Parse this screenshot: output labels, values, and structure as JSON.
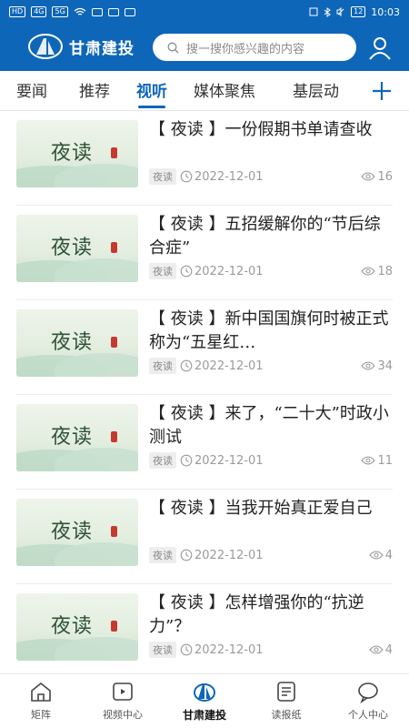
{
  "status_bar": {
    "left_indicators": [
      "HD",
      "4G",
      "5G"
    ],
    "time": "10:03",
    "battery": "12"
  },
  "header": {
    "app_title": "甘肃建投",
    "search_placeholder": "搜一搜你感兴趣的内容",
    "brand_color": "#0e66b8"
  },
  "tabs": [
    {
      "label": "要闻",
      "active": false
    },
    {
      "label": "推荐",
      "active": false
    },
    {
      "label": "视听",
      "active": true
    },
    {
      "label": "媒体聚焦",
      "active": false
    },
    {
      "label": "基层动",
      "active": false
    }
  ],
  "thumb_text": "夜读",
  "articles": [
    {
      "title": "【 夜读 】一份假期书单请查收",
      "tag": "夜读",
      "date": "2022-12-01",
      "views": "16"
    },
    {
      "title": "【 夜读 】五招缓解你的“节后综合症”",
      "tag": "夜读",
      "date": "2022-12-01",
      "views": "18"
    },
    {
      "title": "【 夜读 】新中国国旗何时被正式称为“五星红…",
      "tag": "夜读",
      "date": "2022-12-01",
      "views": "34"
    },
    {
      "title": "【 夜读 】来了，“二十大”时政小测试",
      "tag": "夜读",
      "date": "2022-12-01",
      "views": "11"
    },
    {
      "title": "【 夜读 】当我开始真正爱自己",
      "tag": "夜读",
      "date": "2022-12-01",
      "views": "4"
    },
    {
      "title": "【 夜读 】怎样增强你的“抗逆力”？",
      "tag": "夜读",
      "date": "2022-12-01",
      "views": "4"
    }
  ],
  "bottom_nav": [
    {
      "label": "矩阵",
      "icon": "home-icon"
    },
    {
      "label": "视频中心",
      "icon": "video-icon"
    },
    {
      "label": "甘肃建投",
      "icon": "logo-icon"
    },
    {
      "label": "读报纸",
      "icon": "newspaper-icon"
    },
    {
      "label": "个人中心",
      "icon": "chat-icon"
    }
  ]
}
